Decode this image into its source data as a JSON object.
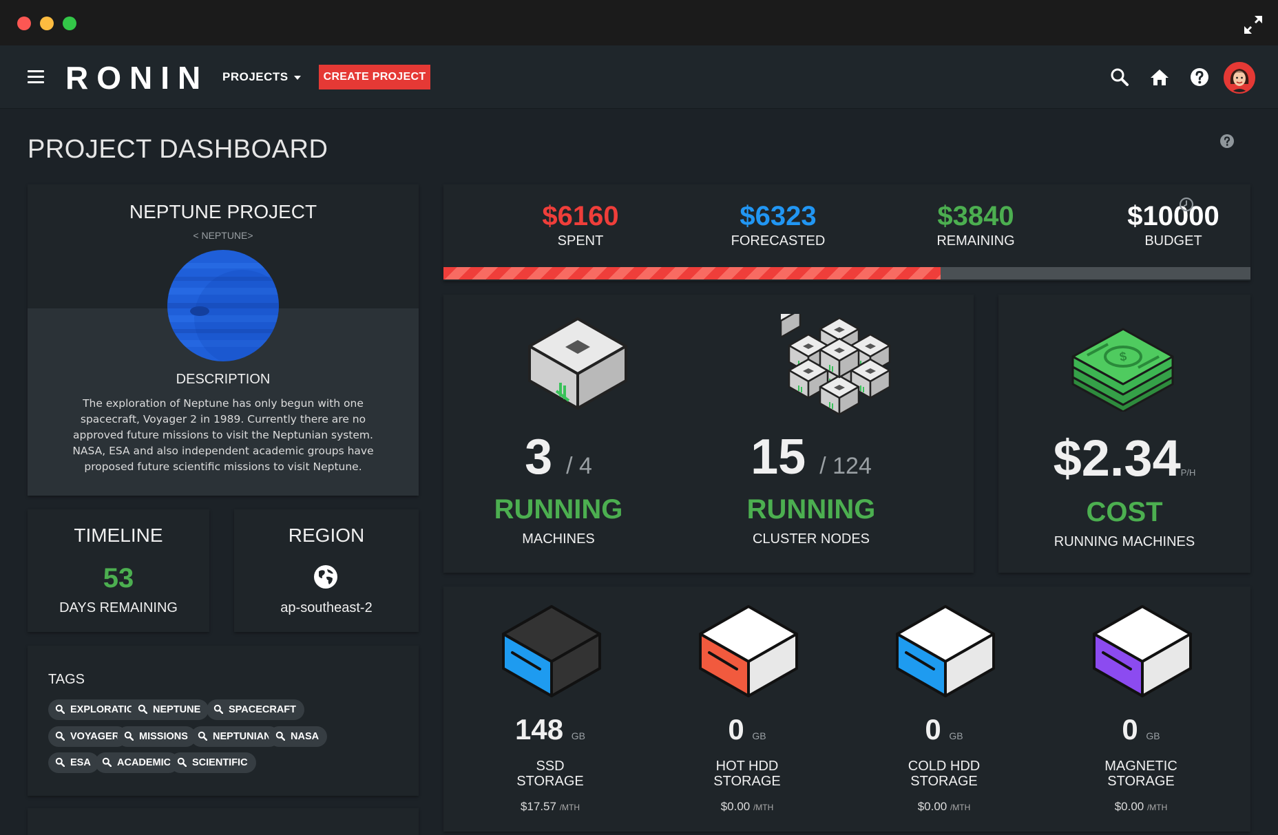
{
  "app": {
    "logo": "RONIN",
    "projects_menu": "PROJECTS",
    "create_button": "CREATE PROJECT"
  },
  "page": {
    "title": "PROJECT DASHBOARD"
  },
  "project": {
    "name": "NEPTUNE PROJECT",
    "slug": "< NEPTUNE>",
    "description_title": "DESCRIPTION",
    "description": "The exploration of Neptune has only begun with one spacecraft, Voyager 2 in 1989. Currently there are no approved future missions to visit the Neptunian system. NASA, ESA and also independent academic groups have proposed future scientific missions to visit Neptune."
  },
  "timeline": {
    "title": "TIMELINE",
    "days": "53",
    "label": "DAYS REMAINING"
  },
  "region": {
    "title": "REGION",
    "value": "ap-southeast-2"
  },
  "tags": {
    "title": "TAGS",
    "items": [
      "EXPLORATION",
      "NEPTUNE",
      "SPACECRAFT",
      "VOYAGER",
      "MISSIONS",
      "NEPTUNIAN",
      "NASA",
      "ESA",
      "ACADEMIC",
      "SCIENTIFIC"
    ]
  },
  "budget": {
    "spent": "$6160",
    "spent_label": "SPENT",
    "forecasted": "$6323",
    "forecasted_label": "FORECASTED",
    "remaining": "$3840",
    "remaining_label": "REMAINING",
    "budget": "$10000",
    "budget_label": "BUDGET",
    "spent_fraction": 0.616,
    "colors": {
      "spent": "#ef3e3a",
      "forecasted": "#2196f3",
      "remaining": "#4caf50",
      "budget": "#ffffff"
    }
  },
  "machines": {
    "running": "3",
    "total": "/ 4",
    "status": "RUNNING",
    "label": "MACHINES"
  },
  "cluster": {
    "running": "15",
    "total": "/ 124",
    "status": "RUNNING",
    "label": "CLUSTER NODES"
  },
  "cost": {
    "value": "$2.34",
    "unit": "P/H",
    "status": "COST",
    "label": "RUNNING MACHINES"
  },
  "storage": [
    {
      "value": "148",
      "unit": "GB",
      "label1": "SSD",
      "label2": "STORAGE",
      "price": "$17.57",
      "price_unit": "/MTH",
      "color": "#1e9bf0"
    },
    {
      "value": "0",
      "unit": "GB",
      "label1": "HOT HDD",
      "label2": "STORAGE",
      "price": "$0.00",
      "price_unit": "/MTH",
      "color": "#f15a3e"
    },
    {
      "value": "0",
      "unit": "GB",
      "label1": "COLD HDD",
      "label2": "STORAGE",
      "price": "$0.00",
      "price_unit": "/MTH",
      "color": "#1e9bf0"
    },
    {
      "value": "0",
      "unit": "GB",
      "label1": "MAGNETIC",
      "label2": "STORAGE",
      "price": "$0.00",
      "price_unit": "/MTH",
      "color": "#8c4bf0"
    }
  ]
}
